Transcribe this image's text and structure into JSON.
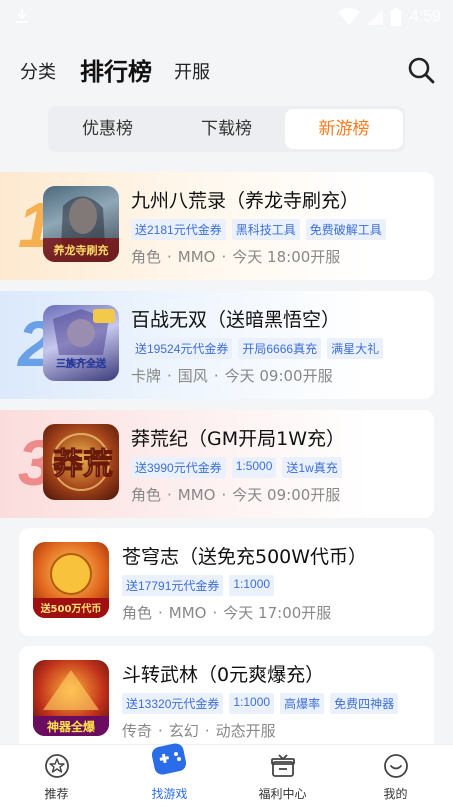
{
  "status_bar": {
    "time": "4:59"
  },
  "top_nav": {
    "items": [
      "分类",
      "排行榜",
      "开服"
    ]
  },
  "segment": {
    "items": [
      "优惠榜",
      "下载榜",
      "新游榜"
    ],
    "active_index": 2
  },
  "games": [
    {
      "rank": "1",
      "title": "九州八荒录（养龙寺刷充）",
      "tags": [
        "送2181元代金券",
        "黑科技工具",
        "免费破解工具"
      ],
      "meta": [
        "角色",
        "MMO",
        "今天 18:00开服"
      ],
      "icon_caption": "养龙寺刷充"
    },
    {
      "rank": "2",
      "title": "百战无双（送暗黑悟空）",
      "tags": [
        "送19524元代金券",
        "开局6666真充",
        "满星大礼"
      ],
      "meta": [
        "卡牌",
        "国风",
        "今天 09:00开服"
      ],
      "icon_caption": "三族齐全送"
    },
    {
      "rank": "3",
      "title": "莽荒纪（GM开局1W充）",
      "tags": [
        "送3990元代金券",
        "1:5000",
        "送1w真充"
      ],
      "meta": [
        "角色",
        "MMO",
        "今天 09:00开服"
      ],
      "icon_caption": "莽荒"
    },
    {
      "rank": "",
      "title": "苍穹志（送免充500W代币）",
      "tags": [
        "送17791元代金券",
        "1:1000"
      ],
      "meta": [
        "角色",
        "MMO",
        "今天 17:00开服"
      ],
      "icon_caption": "送500万代币"
    },
    {
      "rank": "",
      "title": "斗转武林（0元爽爆充）",
      "tags": [
        "送13320元代金券",
        "1:1000",
        "高爆率",
        "免费四神器"
      ],
      "meta": [
        "传奇",
        "玄幻",
        "动态开服"
      ],
      "icon_caption": "神器全爆"
    }
  ],
  "bottom_tabs": [
    {
      "label": "推荐",
      "icon": "star-icon"
    },
    {
      "label": "找游戏",
      "icon": "gamepad-icon"
    },
    {
      "label": "福利中心",
      "icon": "gift-icon"
    },
    {
      "label": "我的",
      "icon": "smile-icon"
    }
  ],
  "colors": {
    "accent": "#ff7a1a",
    "tag_blue": "#3d6fd6",
    "tab_active": "#2b6de8"
  }
}
